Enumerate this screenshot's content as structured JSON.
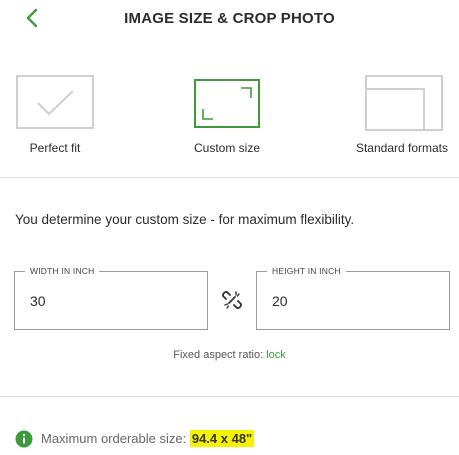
{
  "header": {
    "title": "IMAGE SIZE & CROP PHOTO",
    "back_icon": "chevron-left-icon"
  },
  "options": [
    {
      "label": "Perfect fit",
      "icon": "checkmark-frame-icon",
      "selected": false
    },
    {
      "label": "Custom size",
      "icon": "crop-corners-icon",
      "selected": true
    },
    {
      "label": "Standard formats",
      "icon": "stacked-formats-icon",
      "selected": false
    }
  ],
  "intro": "You determine your custom size - for maximum flexibility.",
  "width": {
    "label": "WIDTH IN INCH",
    "value": "30"
  },
  "height": {
    "label": "HEIGHT IN INCH",
    "value": "20"
  },
  "link_icon": "unlinked-chain-icon",
  "aspect": {
    "prefix": "Fixed aspect ratio:",
    "action": "lock"
  },
  "max_size": {
    "label": "Maximum orderable size:",
    "value": "94.4 x 48\"",
    "icon": "info-icon"
  },
  "colors": {
    "accent": "#3d9a3d",
    "border": "#9a9a9a",
    "highlight": "#f6f300",
    "thumb_inactive": "#cfcfcf"
  }
}
